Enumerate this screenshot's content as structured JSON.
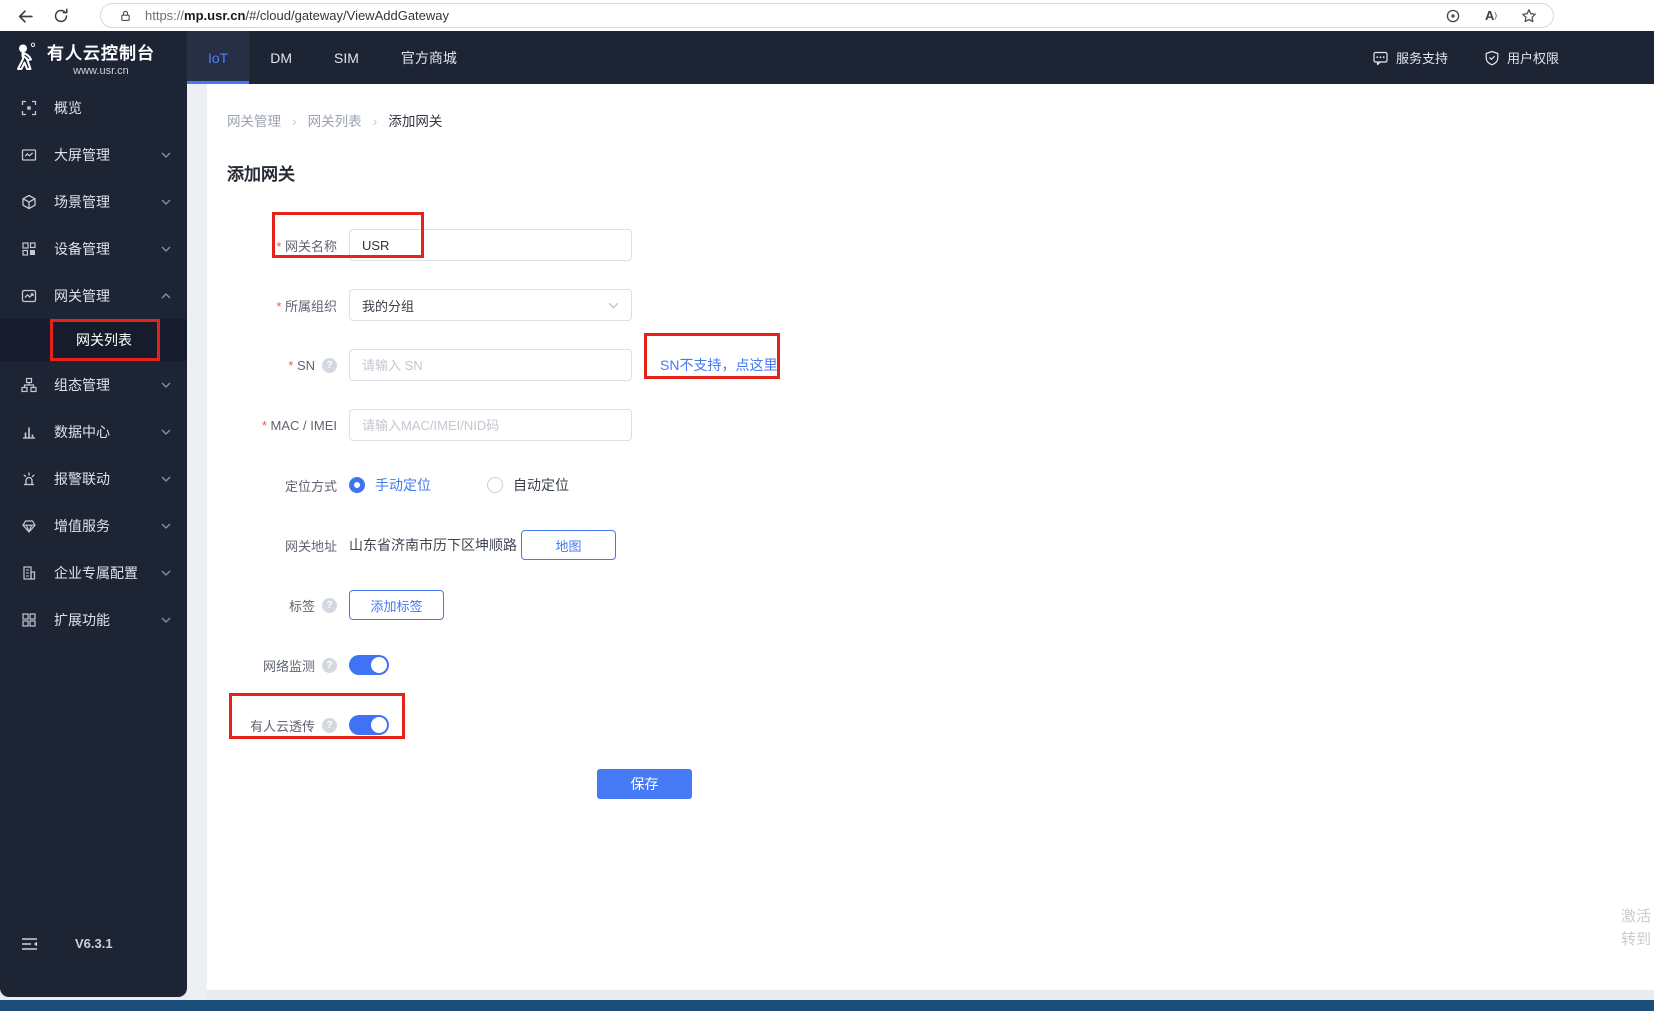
{
  "browser": {
    "url_scheme": "https://",
    "url_host": "mp.usr.cn",
    "url_path": "/#/cloud/gateway/ViewAddGateway"
  },
  "topnav": {
    "brand_title": "有人云控制台",
    "brand_subtitle": "www.usr.cn",
    "tabs": [
      {
        "label": "IoT",
        "active": true
      },
      {
        "label": "DM",
        "active": false
      },
      {
        "label": "SIM",
        "active": false
      },
      {
        "label": "官方商城",
        "active": false
      }
    ],
    "support_label": "服务支持",
    "permission_label": "用户权限"
  },
  "sidebar": {
    "items": [
      {
        "label": "概览"
      },
      {
        "label": "大屏管理"
      },
      {
        "label": "场景管理"
      },
      {
        "label": "设备管理"
      },
      {
        "label": "网关管理"
      },
      {
        "label": "组态管理"
      },
      {
        "label": "数据中心"
      },
      {
        "label": "报警联动"
      },
      {
        "label": "增值服务"
      },
      {
        "label": "企业专属配置"
      },
      {
        "label": "扩展功能"
      }
    ],
    "submenu_gateway_list": "网关列表",
    "version": "V6.3.1"
  },
  "breadcrumb": {
    "items": [
      {
        "label": "网关管理"
      },
      {
        "label": "网关列表"
      },
      {
        "label": "添加网关"
      }
    ]
  },
  "page": {
    "title": "添加网关"
  },
  "form": {
    "gateway_name": {
      "label": "网关名称",
      "value": "USR"
    },
    "organization": {
      "label": "所属组织",
      "value": "我的分组"
    },
    "sn": {
      "label": "SN",
      "placeholder": "请输入 SN",
      "help_link": "SN不支持，点这里"
    },
    "mac": {
      "label": "MAC / IMEI",
      "placeholder": "请输入MAC/IMEI/NID码"
    },
    "location_mode": {
      "label": "定位方式",
      "manual": "手动定位",
      "auto": "自动定位"
    },
    "address": {
      "label": "网关地址",
      "value": "山东省济南市历下区坤顺路",
      "map_button": "地图"
    },
    "tags": {
      "label": "标签",
      "add_button": "添加标签"
    },
    "network_monitor": {
      "label": "网络监测",
      "enabled": true
    },
    "cloud_passthrough": {
      "label": "有人云透传",
      "enabled": true
    },
    "save_button": "保存"
  },
  "watermark": {
    "line1": "激活",
    "line2": "转到"
  },
  "colors": {
    "accent_blue": "#4579f2",
    "annotation_red": "#e5231b",
    "nav_dark": "#1d2434",
    "taskbar_blue": "#1b4e79"
  }
}
